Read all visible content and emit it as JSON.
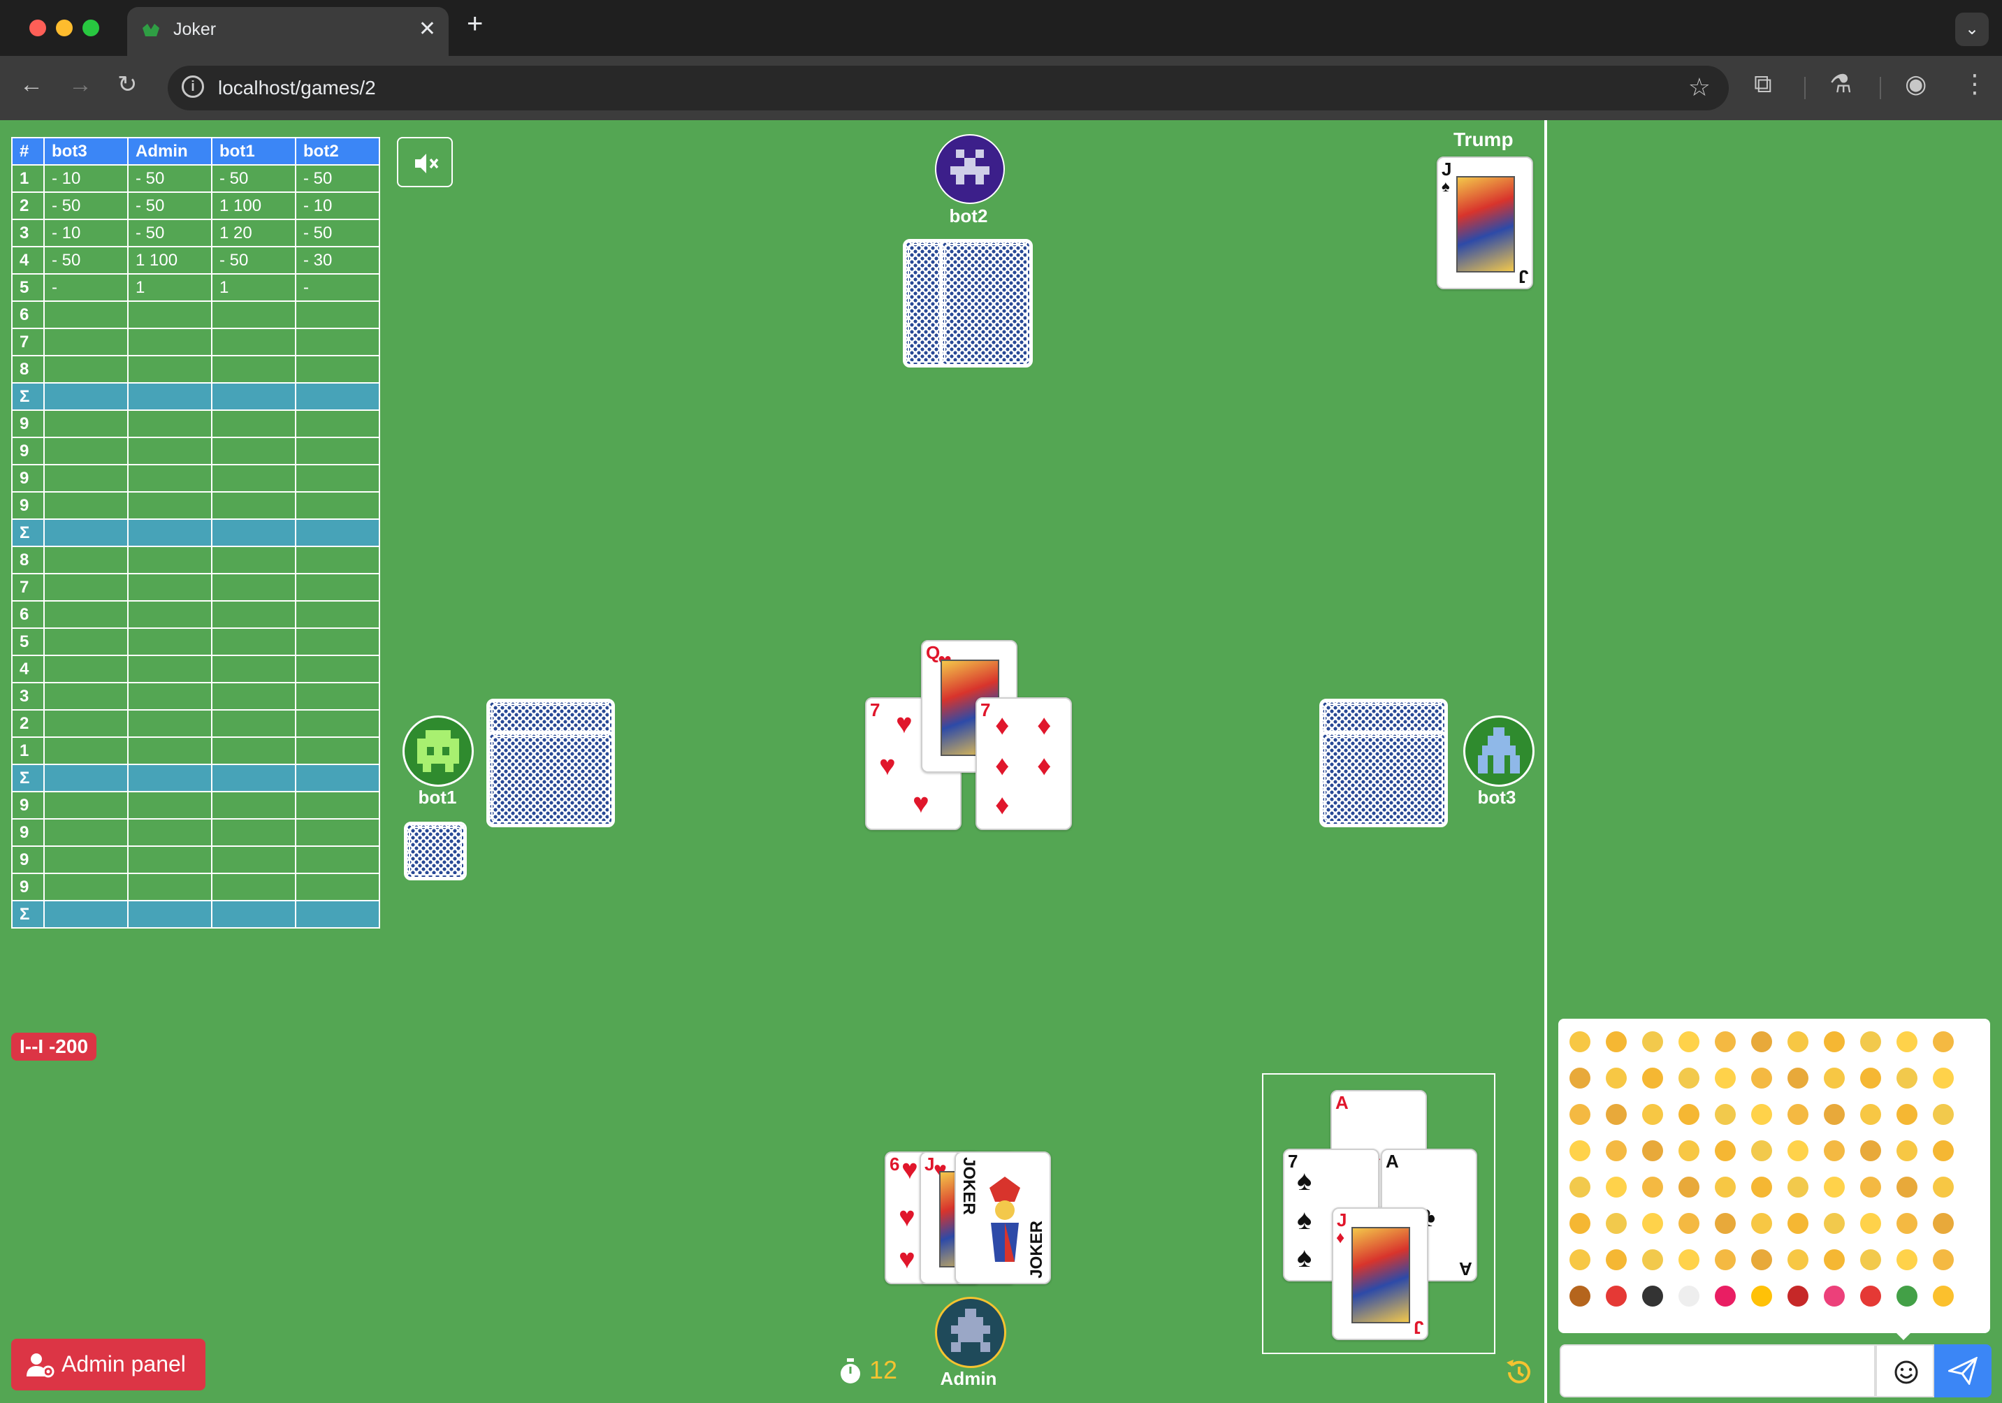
{
  "browser": {
    "tab_title": "Joker",
    "url": "localhost/games/2",
    "new_tab": "+",
    "close": "✕"
  },
  "scoreboard": {
    "headers": [
      "#",
      "bot3",
      "Admin",
      "bot1",
      "bot2"
    ],
    "rows": [
      {
        "n": "1",
        "cells": [
          "- 10",
          "- 50",
          "- 50",
          "- 50"
        ]
      },
      {
        "n": "2",
        "cells": [
          "- 50",
          "- 50",
          "1 100",
          "- 10"
        ]
      },
      {
        "n": "3",
        "cells": [
          "- 10",
          "- 50",
          "1 20",
          "- 50"
        ]
      },
      {
        "n": "4",
        "cells": [
          "- 50",
          "1 100",
          "- 50",
          "- 30"
        ]
      },
      {
        "n": "5",
        "cells": [
          "-",
          "1",
          "1",
          "-"
        ]
      },
      {
        "n": "6",
        "cells": [
          "",
          "",
          "",
          ""
        ]
      },
      {
        "n": "7",
        "cells": [
          "",
          "",
          "",
          ""
        ]
      },
      {
        "n": "8",
        "cells": [
          "",
          "",
          "",
          ""
        ]
      },
      {
        "n": "Σ",
        "cells": [
          "",
          "",
          "",
          ""
        ],
        "sum": true
      },
      {
        "n": "9",
        "cells": [
          "",
          "",
          "",
          ""
        ]
      },
      {
        "n": "9",
        "cells": [
          "",
          "",
          "",
          ""
        ]
      },
      {
        "n": "9",
        "cells": [
          "",
          "",
          "",
          ""
        ]
      },
      {
        "n": "9",
        "cells": [
          "",
          "",
          "",
          ""
        ]
      },
      {
        "n": "Σ",
        "cells": [
          "",
          "",
          "",
          ""
        ],
        "sum": true
      },
      {
        "n": "8",
        "cells": [
          "",
          "",
          "",
          ""
        ]
      },
      {
        "n": "7",
        "cells": [
          "",
          "",
          "",
          ""
        ]
      },
      {
        "n": "6",
        "cells": [
          "",
          "",
          "",
          ""
        ]
      },
      {
        "n": "5",
        "cells": [
          "",
          "",
          "",
          ""
        ]
      },
      {
        "n": "4",
        "cells": [
          "",
          "",
          "",
          ""
        ]
      },
      {
        "n": "3",
        "cells": [
          "",
          "",
          "",
          ""
        ]
      },
      {
        "n": "2",
        "cells": [
          "",
          "",
          "",
          ""
        ]
      },
      {
        "n": "1",
        "cells": [
          "",
          "",
          "",
          ""
        ]
      },
      {
        "n": "Σ",
        "cells": [
          "",
          "",
          "",
          ""
        ],
        "sum": true
      },
      {
        "n": "9",
        "cells": [
          "",
          "",
          "",
          ""
        ]
      },
      {
        "n": "9",
        "cells": [
          "",
          "",
          "",
          ""
        ]
      },
      {
        "n": "9",
        "cells": [
          "",
          "",
          "",
          ""
        ]
      },
      {
        "n": "9",
        "cells": [
          "",
          "",
          "",
          ""
        ]
      },
      {
        "n": "Σ",
        "cells": [
          "",
          "",
          "",
          ""
        ],
        "sum": true
      }
    ]
  },
  "penalty_badge": "I--I -200",
  "admin_button": "Admin panel",
  "players": {
    "top": "bot2",
    "left": "bot1",
    "right": "bot3",
    "bottom": "Admin"
  },
  "trump": {
    "label": "Trump",
    "card": {
      "rank": "J",
      "suit": "♠"
    }
  },
  "table_cards": [
    {
      "rank": "7",
      "suit": "♥"
    },
    {
      "rank": "Q",
      "suit": "♥"
    },
    {
      "rank": "7",
      "suit": "♦"
    }
  ],
  "hand": [
    {
      "rank": "6",
      "suit": "♥"
    },
    {
      "rank": "J",
      "suit": "♥"
    },
    {
      "rank": "JOKER",
      "suit": ""
    }
  ],
  "last_trick": [
    {
      "rank": "A",
      "suit": "♦"
    },
    {
      "rank": "7",
      "suit": "♠"
    },
    {
      "rank": "A",
      "suit": "♣"
    },
    {
      "rank": "J",
      "suit": "♦"
    }
  ],
  "timer": "12",
  "colors": {
    "felt": "#54a653",
    "score_header": "#3b86f6",
    "sum_row": "#47a3b8",
    "danger": "#dc3545",
    "timer": "#f5c330",
    "send": "#3b86f6"
  },
  "chat": {
    "placeholder": "",
    "emoji_count": 88
  }
}
